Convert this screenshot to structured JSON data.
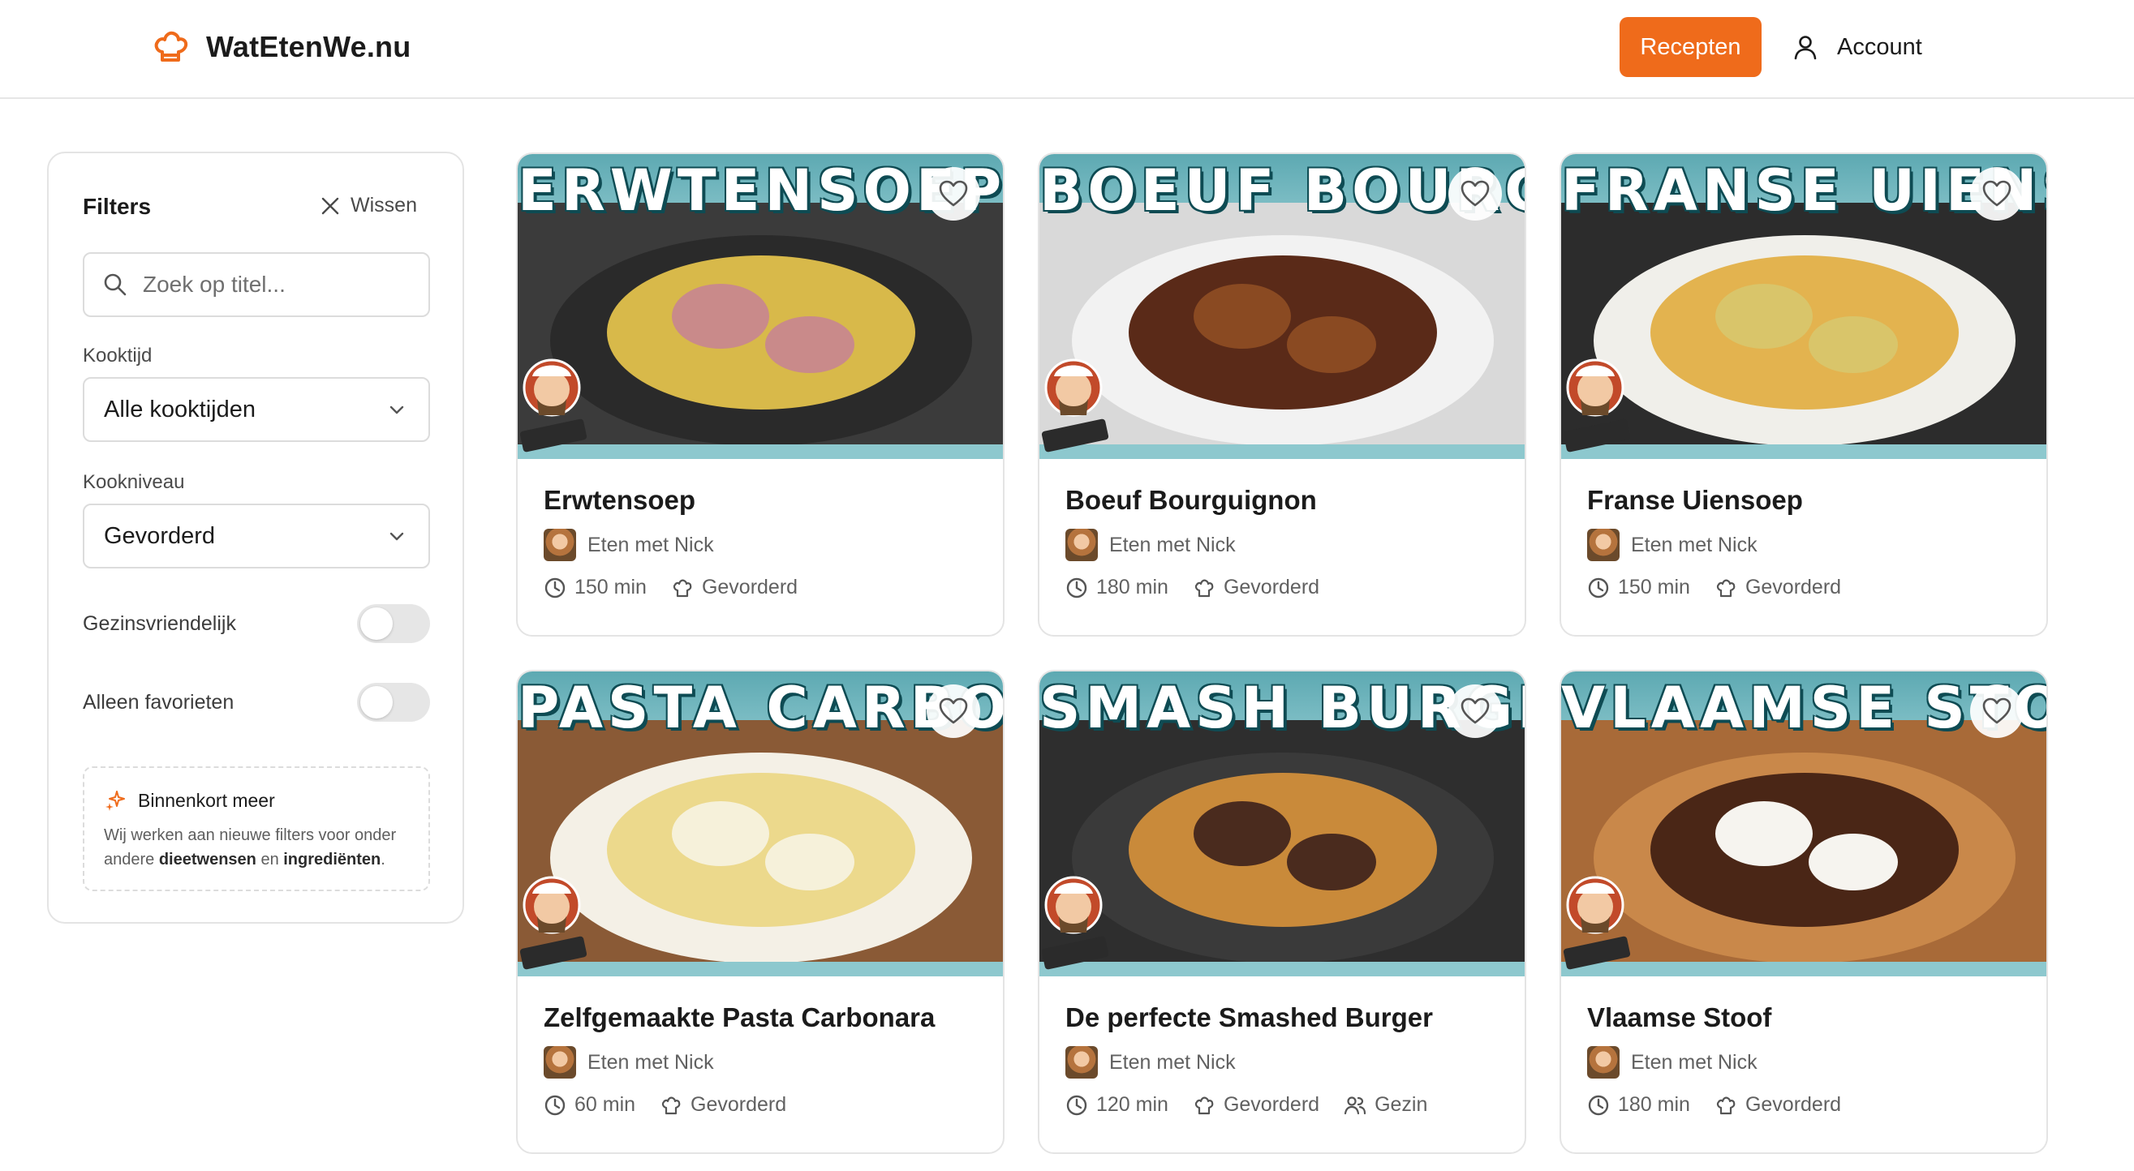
{
  "header": {
    "logo_text": "WatEtenWe.nu",
    "recepten_label": "Recepten",
    "account_label": "Account",
    "accent_color": "#ef6b1b"
  },
  "filters": {
    "title": "Filters",
    "clear_label": "Wissen",
    "search_placeholder": "Zoek op titel...",
    "kooktijd_label": "Kooktijd",
    "kooktijd_value": "Alle kooktijden",
    "kookniveau_label": "Kookniveau",
    "kookniveau_value": "Gevorderd",
    "family_label": "Gezinsvriendelijk",
    "family_on": false,
    "favorites_label": "Alleen favorieten",
    "favorites_on": false,
    "soon_title": "Binnenkort meer",
    "soon_text_1": "Wij werken aan nieuwe filters voor onder andere ",
    "soon_bold_1": "dieetwensen",
    "soon_text_2": " en ",
    "soon_bold_2": "ingrediënten",
    "soon_text_3": "."
  },
  "recipes": [
    {
      "thumb_title": "ERWTENSOEP",
      "title": "Erwtensoep",
      "author": "Eten met Nick",
      "time": "150 min",
      "level": "Gevorderd",
      "extra": ""
    },
    {
      "thumb_title": "BOEUF BOURGUIGNON",
      "title": "Boeuf Bourguignon",
      "author": "Eten met Nick",
      "time": "180 min",
      "level": "Gevorderd",
      "extra": ""
    },
    {
      "thumb_title": "FRANSE UIENSOEP",
      "title": "Franse Uiensoep",
      "author": "Eten met Nick",
      "time": "150 min",
      "level": "Gevorderd",
      "extra": ""
    },
    {
      "thumb_title": "PASTA CARBONARA",
      "title": "Zelfgemaakte Pasta Carbonara",
      "author": "Eten met Nick",
      "time": "60 min",
      "level": "Gevorderd",
      "extra": ""
    },
    {
      "thumb_title": "SMASH BURGER",
      "title": "De perfecte Smashed Burger",
      "author": "Eten met Nick",
      "time": "120 min",
      "level": "Gevorderd",
      "extra": "Gezin"
    },
    {
      "thumb_title": "VLAAMSE STOOF",
      "title": "Vlaamse Stoof",
      "author": "Eten met Nick",
      "time": "180 min",
      "level": "Gevorderd",
      "extra": ""
    }
  ]
}
